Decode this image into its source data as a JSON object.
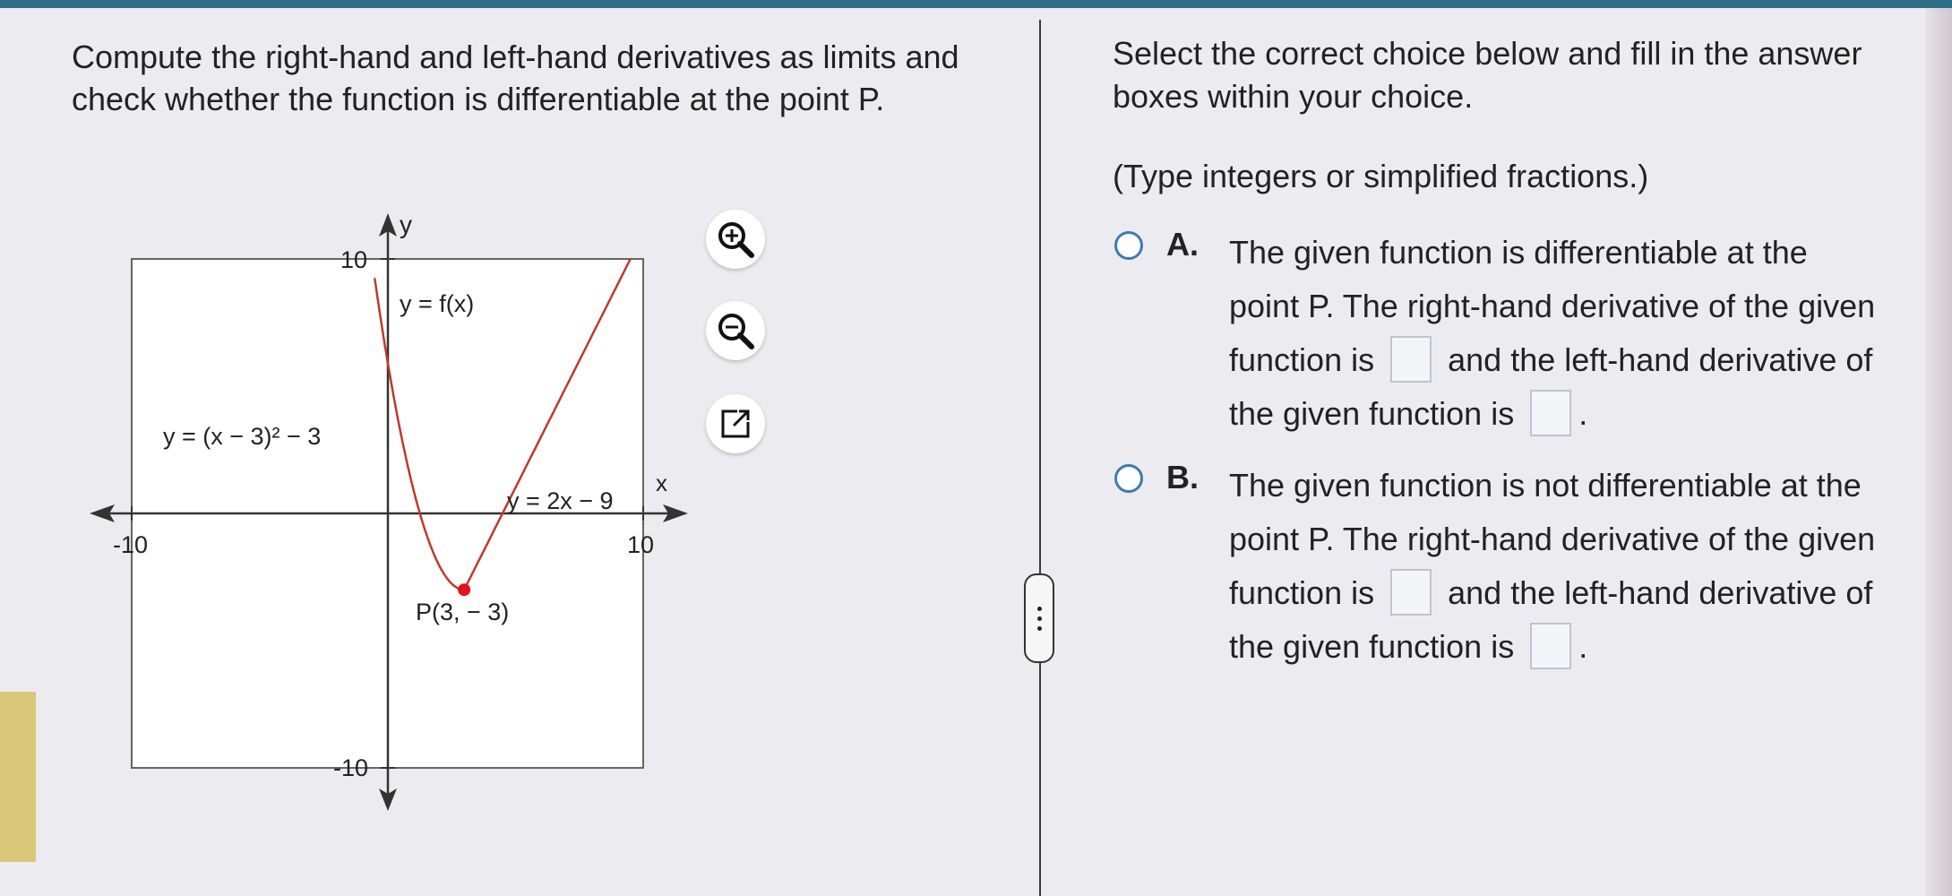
{
  "question": {
    "text": "Compute the right-hand and left-hand derivatives as limits and check whether the function is differentiable at the point P."
  },
  "graph": {
    "y_axis_label": "y",
    "x_axis_label": "x",
    "tick_top": "10",
    "tick_bottom": "-10",
    "tick_left": "-10",
    "tick_right": "10",
    "label_f": "y = f(x)",
    "label_left_piece": "y = (x − 3)² − 3",
    "label_right_piece": "y = 2x − 9",
    "label_point": "P(3, − 3)",
    "curve_color": "#c0392b",
    "point_color": "#e0141e",
    "point": {
      "x": 3,
      "y": -3
    },
    "window": {
      "xmin": -10,
      "xmax": 10,
      "ymin": -10,
      "ymax": 10
    }
  },
  "tools": {
    "zoom_in_icon": "zoom-in-icon",
    "zoom_out_icon": "zoom-out-icon",
    "popout_icon": "popout-icon"
  },
  "instructions": "Select the correct choice below and fill in the answer boxes within your choice.",
  "hint": "(Type integers or simplified fractions.)",
  "choices": {
    "a": {
      "letter": "A.",
      "part1": "The given function is differentiable at the point P. The right-hand derivative of the given function is",
      "part2": "and the left-hand derivative of the given function is",
      "part3": "."
    },
    "b": {
      "letter": "B.",
      "part1": "The given function is not differentiable at the point P. The right-hand derivative of the given function is",
      "part2": "and the left-hand derivative of the given function is",
      "part3": "."
    }
  }
}
